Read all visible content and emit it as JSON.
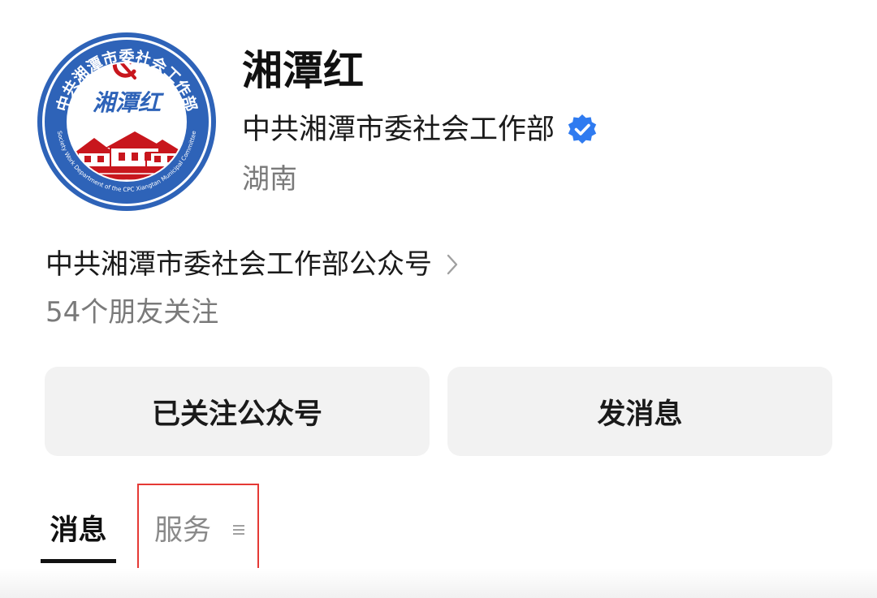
{
  "profile": {
    "name": "湘潭红",
    "organization": "中共湘潭市委社会工作部",
    "region": "湖南",
    "verified_icon": "verified-badge-icon",
    "avatar_icon": "party-emblem-logo",
    "logo_text_cn": "中共湘潭市委社会工作部",
    "logo_text_en": "Society Work Department of the CPC Xiangtan Municipal Committee",
    "logo_script": "湘潭红"
  },
  "account": {
    "name": "中共湘潭市委社会工作部公众号",
    "followers": "54个朋友关注",
    "chevron_icon": "chevron-right-icon"
  },
  "actions": {
    "follow_label": "已关注公众号",
    "message_label": "发消息"
  },
  "tabs": {
    "messages_label": "消息",
    "services_label": "服务",
    "services_icon": "menu-icon"
  },
  "colors": {
    "verified_blue": "#2f7bf0",
    "avatar_ring_blue": "#2e63b8",
    "emblem_red": "#c8161d",
    "highlight_red": "#e53935"
  }
}
